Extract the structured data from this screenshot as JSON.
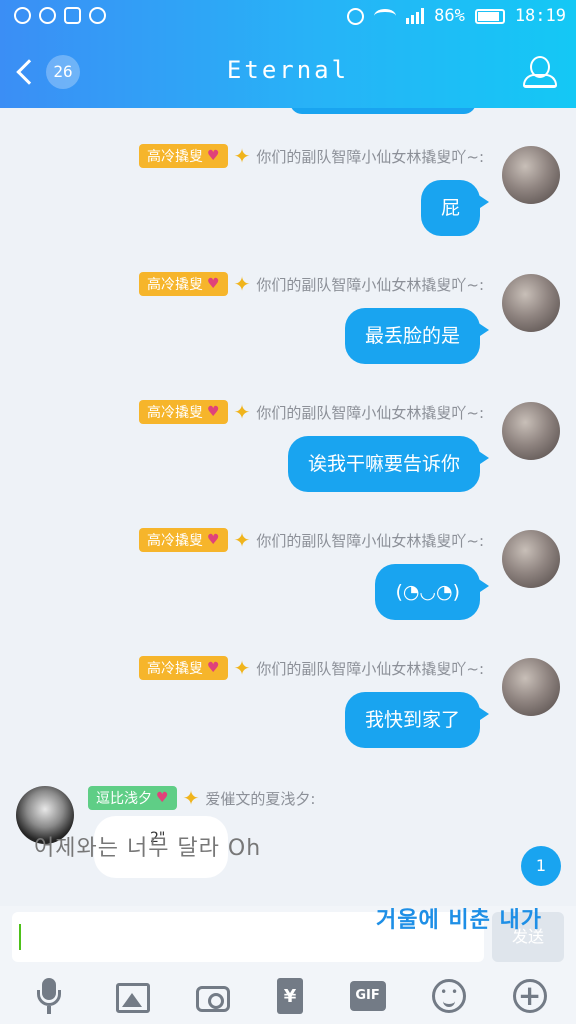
{
  "status_bar": {
    "battery": "86%",
    "time": "18:19"
  },
  "header": {
    "back_count": "26",
    "title": "Eternal"
  },
  "messages": [
    {
      "badge": "高冷撬叟",
      "nick": "你们的副队智障小仙女林撬叟吖~:",
      "text": "屁"
    },
    {
      "badge": "高冷撬叟",
      "nick": "你们的副队智障小仙女林撬叟吖~:",
      "text": "最丢脸的是"
    },
    {
      "badge": "高冷撬叟",
      "nick": "你们的副队智障小仙女林撬叟吖~:",
      "text": "诶我干嘛要告诉你"
    },
    {
      "badge": "高冷撬叟",
      "nick": "你们的副队智障小仙女林撬叟吖~:",
      "text": "(◔◡◔)"
    },
    {
      "badge": "高冷撬叟",
      "nick": "你们的副队智障小仙女林撬叟吖~:",
      "text": "我快到家了"
    }
  ],
  "incoming": {
    "badge": "逗比浅夕",
    "nick": "爱催文的夏浅夕:",
    "voice_duration": "2\"",
    "overlay_text": "어제와는 너무 달라 Oh"
  },
  "new_message_indicator": "1",
  "input": {
    "send_label": "发送",
    "lyric_overlay": "거울에 비춘 내가"
  },
  "toolbar": {
    "redpacket_symbol": "¥",
    "gif_label": "GIF"
  },
  "colors": {
    "header_start": "#3b8ef5",
    "header_end": "#14c8f5",
    "bubble": "#19a4f0",
    "badge_gold": "#f6b52b",
    "badge_green": "#5fce86"
  }
}
